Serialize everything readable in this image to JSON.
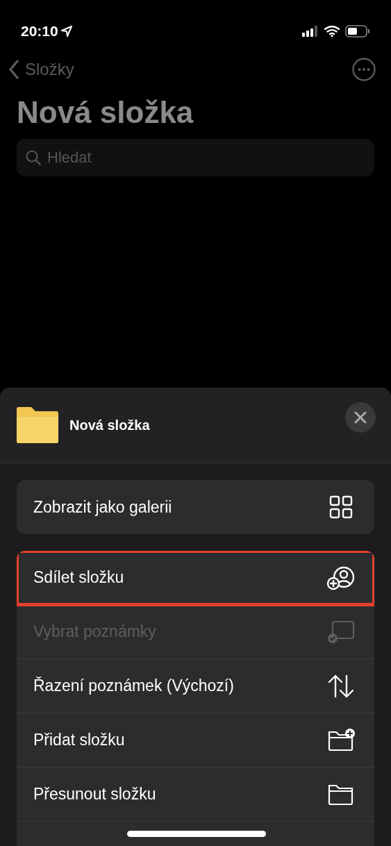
{
  "status_bar": {
    "time": "20:10"
  },
  "nav": {
    "back_label": "Složky"
  },
  "title": "Nová složka",
  "search": {
    "placeholder": "Hledat"
  },
  "sheet": {
    "title": "Nová složka",
    "groups": [
      {
        "items": [
          {
            "label": "Zobrazit jako galerii",
            "disabled": false,
            "highlighted": false
          }
        ]
      },
      {
        "items": [
          {
            "label": "Sdílet složku",
            "disabled": false,
            "highlighted": true
          },
          {
            "label": "Vybrat poznámky",
            "disabled": true,
            "highlighted": false
          },
          {
            "label": "Řazení poznámek (Výchozí)",
            "disabled": false,
            "highlighted": false
          },
          {
            "label": "Přidat složku",
            "disabled": false,
            "highlighted": false
          },
          {
            "label": "Přesunout složku",
            "disabled": false,
            "highlighted": false
          }
        ]
      }
    ]
  }
}
